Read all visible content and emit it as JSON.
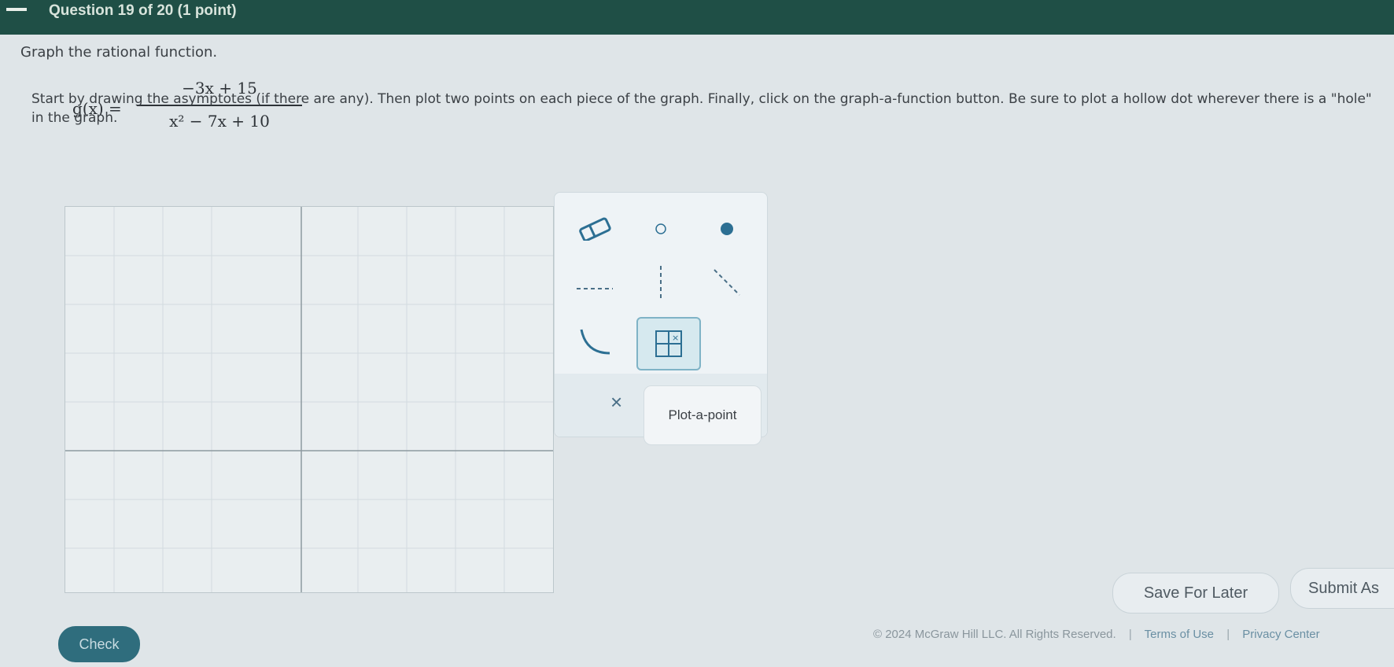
{
  "header": {
    "title": "Question 19 of 20 (1 point)"
  },
  "question": {
    "prompt": "Graph the rational function.",
    "equation": {
      "lhs": "g(x) =",
      "numerator": "−3x + 15",
      "denominator": "x² − 7x + 10"
    },
    "instructions": "Start by drawing the asymptotes (if there are any). Then plot two points on each piece of the graph. Finally, click on the graph-a-function button. Be sure to plot a hollow dot wherever there is a \"hole\" in the graph."
  },
  "toolbox": {
    "tools": [
      {
        "name": "eraser-tool",
        "icon": "eraser-icon"
      },
      {
        "name": "hollow-dot-tool",
        "icon": "hollow-dot-icon"
      },
      {
        "name": "solid-dot-tool",
        "icon": "solid-dot-icon"
      },
      {
        "name": "horizontal-asymptote-tool",
        "icon": "horizontal-dashed-line-icon"
      },
      {
        "name": "vertical-asymptote-tool",
        "icon": "vertical-dashed-line-icon"
      },
      {
        "name": "slant-asymptote-tool",
        "icon": "slant-dashed-line-icon"
      },
      {
        "name": "curve-tool",
        "icon": "curve-icon"
      },
      {
        "name": "graph-a-function-tool",
        "icon": "graph-function-icon"
      }
    ],
    "delete_label": "×",
    "tooltip": "Plot-a-point"
  },
  "buttons": {
    "save": "Save For Later",
    "submit": "Submit As",
    "check": "Check"
  },
  "footer": {
    "copyright": "© 2024 McGraw Hill LLC. All Rights Reserved.",
    "terms": "Terms of Use",
    "privacy": "Privacy Center"
  },
  "colors": {
    "header_bg": "#1f4f46",
    "accent": "#2f6d7d",
    "tool_icon": "#2c6f93"
  }
}
